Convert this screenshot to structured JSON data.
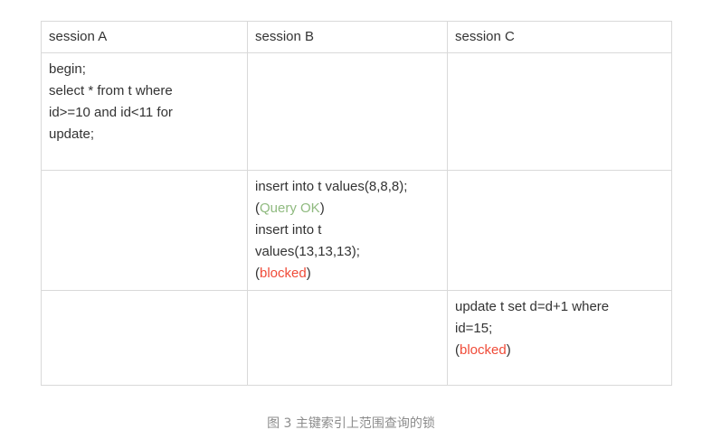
{
  "table": {
    "headers": [
      "session A",
      "session B",
      "session C"
    ],
    "rows": [
      {
        "a": "begin;\nselect * from t where\nid>=10 and id<11 for\nupdate;",
        "b": "",
        "c": ""
      },
      {
        "a": "",
        "b": {
          "line1": "insert into t values(8,8,8);",
          "status1": "Query OK",
          "line2": "insert into t\nvalues(13,13,13);",
          "status2": "blocked"
        },
        "c": ""
      },
      {
        "a": "",
        "b": "",
        "c": {
          "line1": "update t set d=d+1 where\nid=15;",
          "status1": "blocked"
        }
      }
    ],
    "colors": {
      "ok": "#8fba7f",
      "blocked": "#f04b38",
      "border": "#d9d9d9"
    }
  },
  "caption": "图 3 主键索引上范围查询的锁"
}
